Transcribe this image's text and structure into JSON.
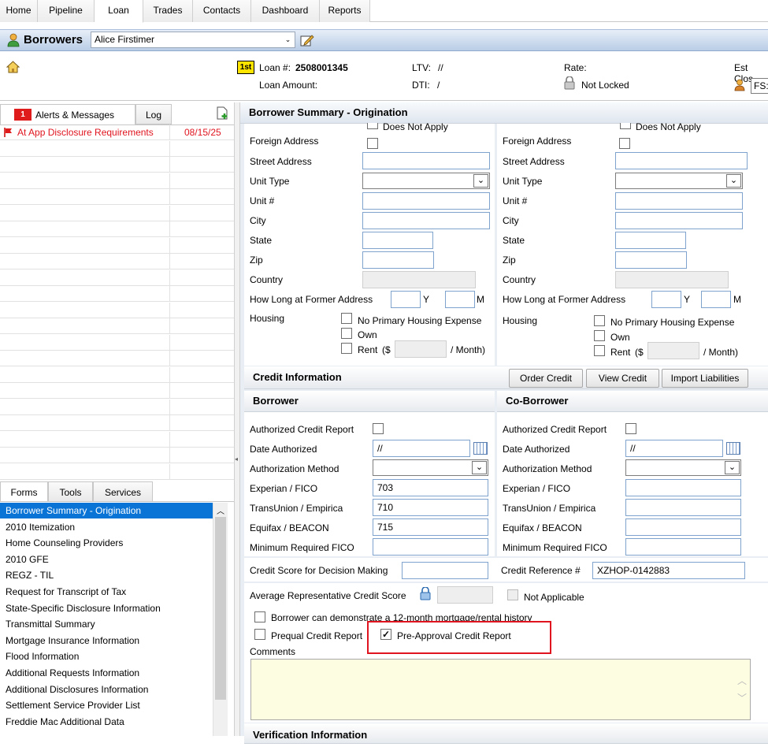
{
  "top_tabs": [
    "Home",
    "Pipeline",
    "Loan",
    "Trades",
    "Contacts",
    "Dashboard",
    "Reports"
  ],
  "borrowers_bar": {
    "title": "Borrowers",
    "selected_borrower": "Alice Firstimer"
  },
  "loan_info": {
    "loan_num_label": "Loan #:",
    "loan_num": "2508001345",
    "loan_amount_label": "Loan Amount:",
    "ltv_label": "LTV:",
    "ltv_value": "//",
    "dti_label": "DTI:",
    "dti_value": "/",
    "rate_label": "Rate:",
    "lock_status": "Not Locked",
    "est_close_label": "Est Clos",
    "fs_value": "FS:",
    "first_badge": "1st"
  },
  "left_panel": {
    "tabs": [
      "Alerts & Messages",
      "Log"
    ],
    "alert_count": "1",
    "alerts": [
      {
        "text": "At App Disclosure Requirements",
        "date": "08/15/25"
      }
    ],
    "bottom_tabs": [
      "Forms",
      "Tools",
      "Services"
    ],
    "forms": [
      "Borrower Summary - Origination",
      "2010 Itemization",
      "Home Counseling Providers",
      "2010 GFE",
      "REGZ - TIL",
      "Request for Transcript of Tax",
      "State-Specific Disclosure Information",
      "Transmittal Summary",
      "Mortgage Insurance Information",
      "Flood Information",
      "Additional Requests Information",
      "Additional Disclosures Information",
      "Settlement Service Provider List",
      "Freddie Mac Additional Data"
    ]
  },
  "main": {
    "title": "Borrower Summary - Origination",
    "address": {
      "does_not_apply": "Does Not Apply",
      "foreign_address": "Foreign Address",
      "street_address": "Street Address",
      "unit_type": "Unit Type",
      "unit_num": "Unit #",
      "city": "City",
      "state": "State",
      "zip": "Zip",
      "country": "Country",
      "how_long": "How Long at Former Address",
      "y": "Y",
      "m": "M",
      "housing": "Housing",
      "no_primary": "No Primary Housing Expense",
      "own": "Own",
      "rent": "Rent",
      "rent_open": "($",
      "per_month": "/ Month)"
    },
    "credit": {
      "title": "Credit Information",
      "buttons": [
        "Order Credit",
        "View Credit",
        "Import Liabilities"
      ],
      "borrower_title": "Borrower",
      "coborrower_title": "Co-Borrower",
      "authorized_report": "Authorized Credit Report",
      "date_authorized": "Date Authorized",
      "authorization_method": "Authorization Method",
      "experian": "Experian / FICO",
      "transunion": "TransUnion / Empirica",
      "equifax": "Equifax / BEACON",
      "min_fico": "Minimum Required FICO",
      "borrower_date": "//",
      "coborrower_date": "//",
      "borrower_experian": "703",
      "borrower_transunion": "710",
      "borrower_equifax": "715",
      "score_decision": "Credit Score for Decision Making",
      "credit_ref_label": "Credit Reference #",
      "credit_ref_value": "XZHOP-0142883",
      "avg_score": "Average Representative Credit Score",
      "not_applicable": "Not Applicable",
      "twelve_month": "Borrower can demonstrate a 12-month mortgage/rental history",
      "prequal": "Prequal Credit Report",
      "preapproval": "Pre-Approval Credit Report",
      "preapproval_checked": "✓",
      "comments": "Comments"
    },
    "verification_title": "Verification Information"
  },
  "colors": {
    "highlight_box": "#e0141e",
    "selected_form": "#0a74d6",
    "alert_text": "#e0141e",
    "comments_bg": "#fdfde2"
  }
}
